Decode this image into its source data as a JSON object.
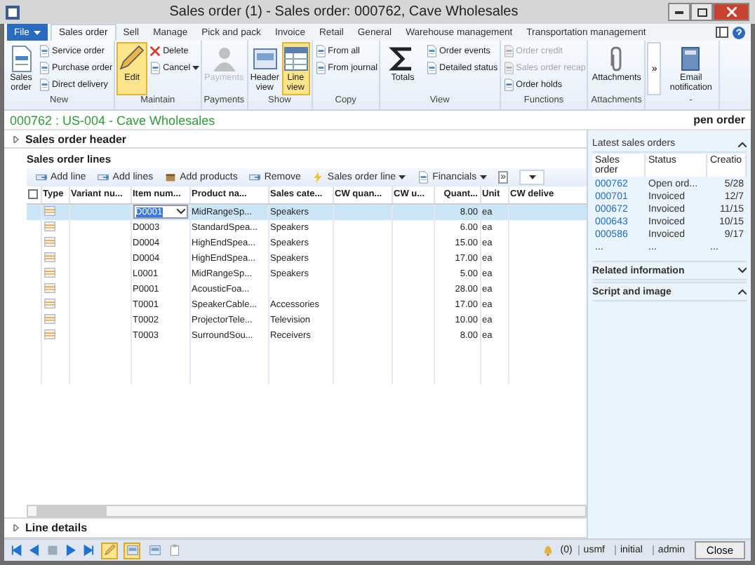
{
  "window": {
    "title": "Sales order (1) - Sales order: 000762, Cave Wholesales"
  },
  "tabs": [
    {
      "label": "File",
      "kind": "file",
      "selected": false
    },
    {
      "label": "Sales order",
      "kind": "tab",
      "selected": true
    },
    {
      "label": "Sell",
      "kind": "tab",
      "selected": false
    },
    {
      "label": "Manage",
      "kind": "tab",
      "selected": false
    },
    {
      "label": "Pick and pack",
      "kind": "tab",
      "selected": false
    },
    {
      "label": "Invoice",
      "kind": "tab",
      "selected": false
    },
    {
      "label": "Retail",
      "kind": "tab",
      "selected": false
    },
    {
      "label": "General",
      "kind": "tab",
      "selected": false
    },
    {
      "label": "Warehouse management",
      "kind": "tab",
      "selected": false
    },
    {
      "label": "Transportation management",
      "kind": "tab",
      "selected": false
    }
  ],
  "ribbon": {
    "groups": [
      {
        "label": "New",
        "buttons": [
          {
            "label": "Sales order",
            "kind": "large",
            "disabled": false,
            "selected": false
          },
          {
            "label": "Service order",
            "kind": "small",
            "disabled": false
          },
          {
            "label": "Purchase order",
            "kind": "small",
            "disabled": false
          },
          {
            "label": "Direct delivery",
            "kind": "small",
            "disabled": false
          }
        ]
      },
      {
        "label": "Maintain",
        "buttons": [
          {
            "label": "Edit",
            "kind": "large",
            "disabled": false,
            "selected": true
          },
          {
            "label": "Delete",
            "kind": "small",
            "disabled": false
          },
          {
            "label": "Cancel",
            "kind": "small",
            "disabled": false,
            "dropdown": true
          }
        ]
      },
      {
        "label": "Payments",
        "buttons": [
          {
            "label": "Payments",
            "kind": "large",
            "disabled": true,
            "selected": false
          }
        ]
      },
      {
        "label": "Show",
        "buttons": [
          {
            "label": "Header view",
            "kind": "large",
            "disabled": false,
            "selected": false
          },
          {
            "label": "Line view",
            "kind": "large",
            "disabled": false,
            "selected": true
          }
        ]
      },
      {
        "label": "Copy",
        "buttons": [
          {
            "label": "From all",
            "kind": "small",
            "disabled": false
          },
          {
            "label": "From journal",
            "kind": "small",
            "disabled": false
          }
        ]
      },
      {
        "label": "View",
        "buttons": [
          {
            "label": "Totals",
            "kind": "large",
            "disabled": false,
            "selected": false
          },
          {
            "label": "Order events",
            "kind": "small",
            "disabled": false
          },
          {
            "label": "Detailed status",
            "kind": "small",
            "disabled": false
          }
        ]
      },
      {
        "label": "Functions",
        "buttons": [
          {
            "label": "Order credit",
            "kind": "small",
            "disabled": true
          },
          {
            "label": "Sales order recap",
            "kind": "small",
            "disabled": true
          },
          {
            "label": "Order holds",
            "kind": "small",
            "disabled": false
          }
        ]
      },
      {
        "label": "Attachments",
        "buttons": [
          {
            "label": "Attachments",
            "kind": "large",
            "disabled": false,
            "selected": false
          }
        ]
      },
      {
        "buttons": [
          {
            "label": "»",
            "kind": "overflow"
          }
        ]
      },
      {
        "label": "-",
        "buttons": [
          {
            "label": "Email notification",
            "kind": "large",
            "disabled": false,
            "selected": false
          }
        ]
      }
    ]
  },
  "order_title": "000762 : US-004 - Cave Wholesales",
  "order_status": "pen order",
  "header_section": {
    "label": "Sales order header",
    "expanded": false
  },
  "lines": {
    "title": "Sales order lines",
    "toolbar": [
      {
        "label": "Add line",
        "kind": "button"
      },
      {
        "label": "Add lines",
        "kind": "button"
      },
      {
        "label": "Add products",
        "kind": "button"
      },
      {
        "label": "Remove",
        "kind": "button"
      },
      {
        "label": "Sales order line",
        "kind": "menu"
      },
      {
        "label": "Financials",
        "kind": "menu"
      },
      {
        "label": "»",
        "kind": "overflow"
      },
      {
        "kind": "select"
      }
    ],
    "all_selected": false,
    "columns": [
      "Type",
      "Variant nu...",
      "Item num...",
      "Product na...",
      "Sales cate...",
      "CW quan...",
      "CW u...",
      "Quant...",
      "Unit",
      "CW delive"
    ],
    "rows": [
      {
        "item": "D0001",
        "product": "MidRangeSp...",
        "category": "Speakers",
        "quantity": "8.00",
        "unit": "ea",
        "selected": true
      },
      {
        "item": "D0003",
        "product": "StandardSpea...",
        "category": "Speakers",
        "quantity": "6.00",
        "unit": "ea",
        "selected": false
      },
      {
        "item": "D0004",
        "product": "HighEndSpea...",
        "category": "Speakers",
        "quantity": "15.00",
        "unit": "ea",
        "selected": false
      },
      {
        "item": "D0004",
        "product": "HighEndSpea...",
        "category": "Speakers",
        "quantity": "17.00",
        "unit": "ea",
        "selected": false
      },
      {
        "item": "L0001",
        "product": "MidRangeSp...",
        "category": "Speakers",
        "quantity": "5.00",
        "unit": "ea",
        "selected": false
      },
      {
        "item": "P0001",
        "product": "AcousticFoa...",
        "quantity": "28.00",
        "unit": "ea",
        "selected": false
      },
      {
        "item": "T0001",
        "product": "SpeakerCable...",
        "category": "Accessories",
        "quantity": "17.00",
        "unit": "ea",
        "selected": false
      },
      {
        "item": "T0002",
        "product": "ProjectorTele...",
        "category": "Television",
        "quantity": "10.00",
        "unit": "ea",
        "selected": false
      },
      {
        "item": "T0003",
        "product": "SurroundSou...",
        "category": "Receivers",
        "quantity": "8.00",
        "unit": "ea",
        "selected": false
      }
    ]
  },
  "line_details": {
    "label": "Line details",
    "expanded": false
  },
  "factbox": {
    "latest": {
      "title": "Latest sales orders",
      "expanded": true,
      "columns": [
        "Sales order",
        "Status",
        "Creatio"
      ],
      "rows": [
        {
          "order": "000762",
          "status": "Open ord...",
          "created": "5/28"
        },
        {
          "order": "000701",
          "status": "Invoiced",
          "created": "12/7"
        },
        {
          "order": "000672",
          "status": "Invoiced",
          "created": "11/15"
        },
        {
          "order": "000643",
          "status": "Invoiced",
          "created": "10/15"
        },
        {
          "order": "000586",
          "status": "Invoiced",
          "created": "9/17"
        }
      ],
      "more": [
        "...",
        "...",
        "..."
      ]
    },
    "panels": [
      {
        "label": "Related information",
        "expanded": false
      },
      {
        "label": "Script and image",
        "expanded": true
      }
    ]
  },
  "status_bar": {
    "edit_mode": true,
    "view_toggles": [
      {
        "selected": true
      },
      {
        "selected": false
      }
    ],
    "alerts": "(0)",
    "company": "usmf",
    "partition": "initial",
    "user": "admin",
    "close": "Close"
  }
}
